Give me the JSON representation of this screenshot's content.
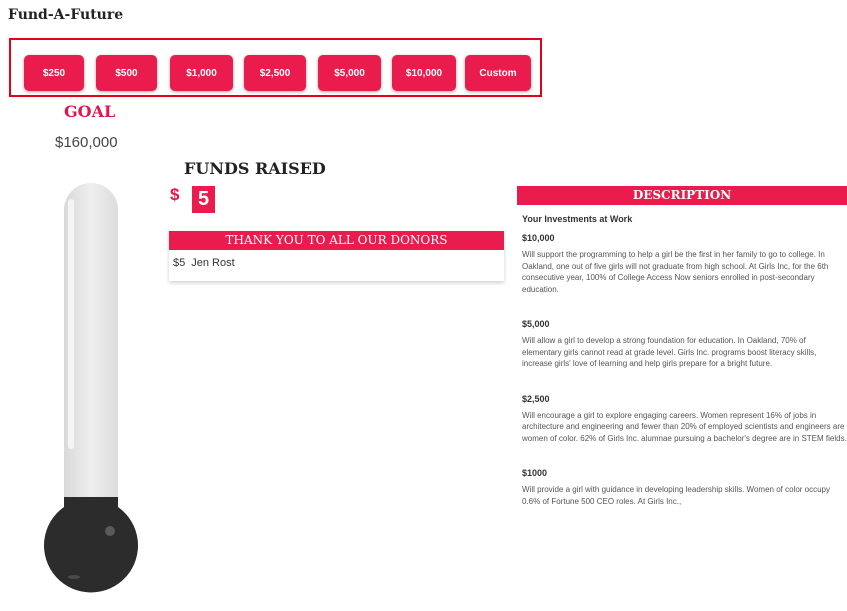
{
  "page": {
    "title": "Fund-A-Future"
  },
  "amounts": [
    "$250",
    "$500",
    "$1,000",
    "$2,500",
    "$5,000",
    "$10,000",
    "Custom"
  ],
  "goal": {
    "label": "GOAL",
    "amount": "$160,000"
  },
  "funds": {
    "title": "FUNDS RAISED",
    "currency": "$",
    "value": "5",
    "progress_fraction": 3.125e-05
  },
  "donors": {
    "header": "THANK YOU TO ALL OUR DONORS",
    "list": [
      {
        "amount": "$5",
        "name": "Jen Rost"
      }
    ]
  },
  "description": {
    "header": "DESCRIPTION",
    "subtitle": "Your Investments at Work",
    "tiers": [
      {
        "amount": "$10,000",
        "text": "Will support the programming to help a girl be the first in her family to go to college. In Oakland, one out of five girls will not graduate from high school. At Girls Inc, for the 6th consecutive year, 100% of College Access Now seniors enrolled in post-secondary education."
      },
      {
        "amount": "$5,000",
        "text": "Will allow a girl to develop a strong foundation for education. In Oakland, 70% of elementary girls cannot read at grade level. Girls Inc. programs boost literacy skills, increase girls' love of learning and help girls prepare for a bright future."
      },
      {
        "amount": "$2,500",
        "text": "Will encourage a girl to explore engaging careers. Women represent 16% of jobs in architecture and engineering and fewer than 20% of employed scientists and engineers are women of color. 62% of Girls Inc. alumnae pursuing a bachelor's degree are in STEM fields."
      },
      {
        "amount": "$1000",
        "text": "Will provide a girl with guidance in developing leadership skills. Women of color occupy 0.6% of Fortune 500 CEO roles. At Girls Inc.,"
      }
    ]
  },
  "colors": {
    "accent": "#ea1c4d",
    "highlight_border": "#e3001b",
    "thermometer_fill": "#2c2c2c",
    "thermometer_tube": "#e4e4e4"
  }
}
